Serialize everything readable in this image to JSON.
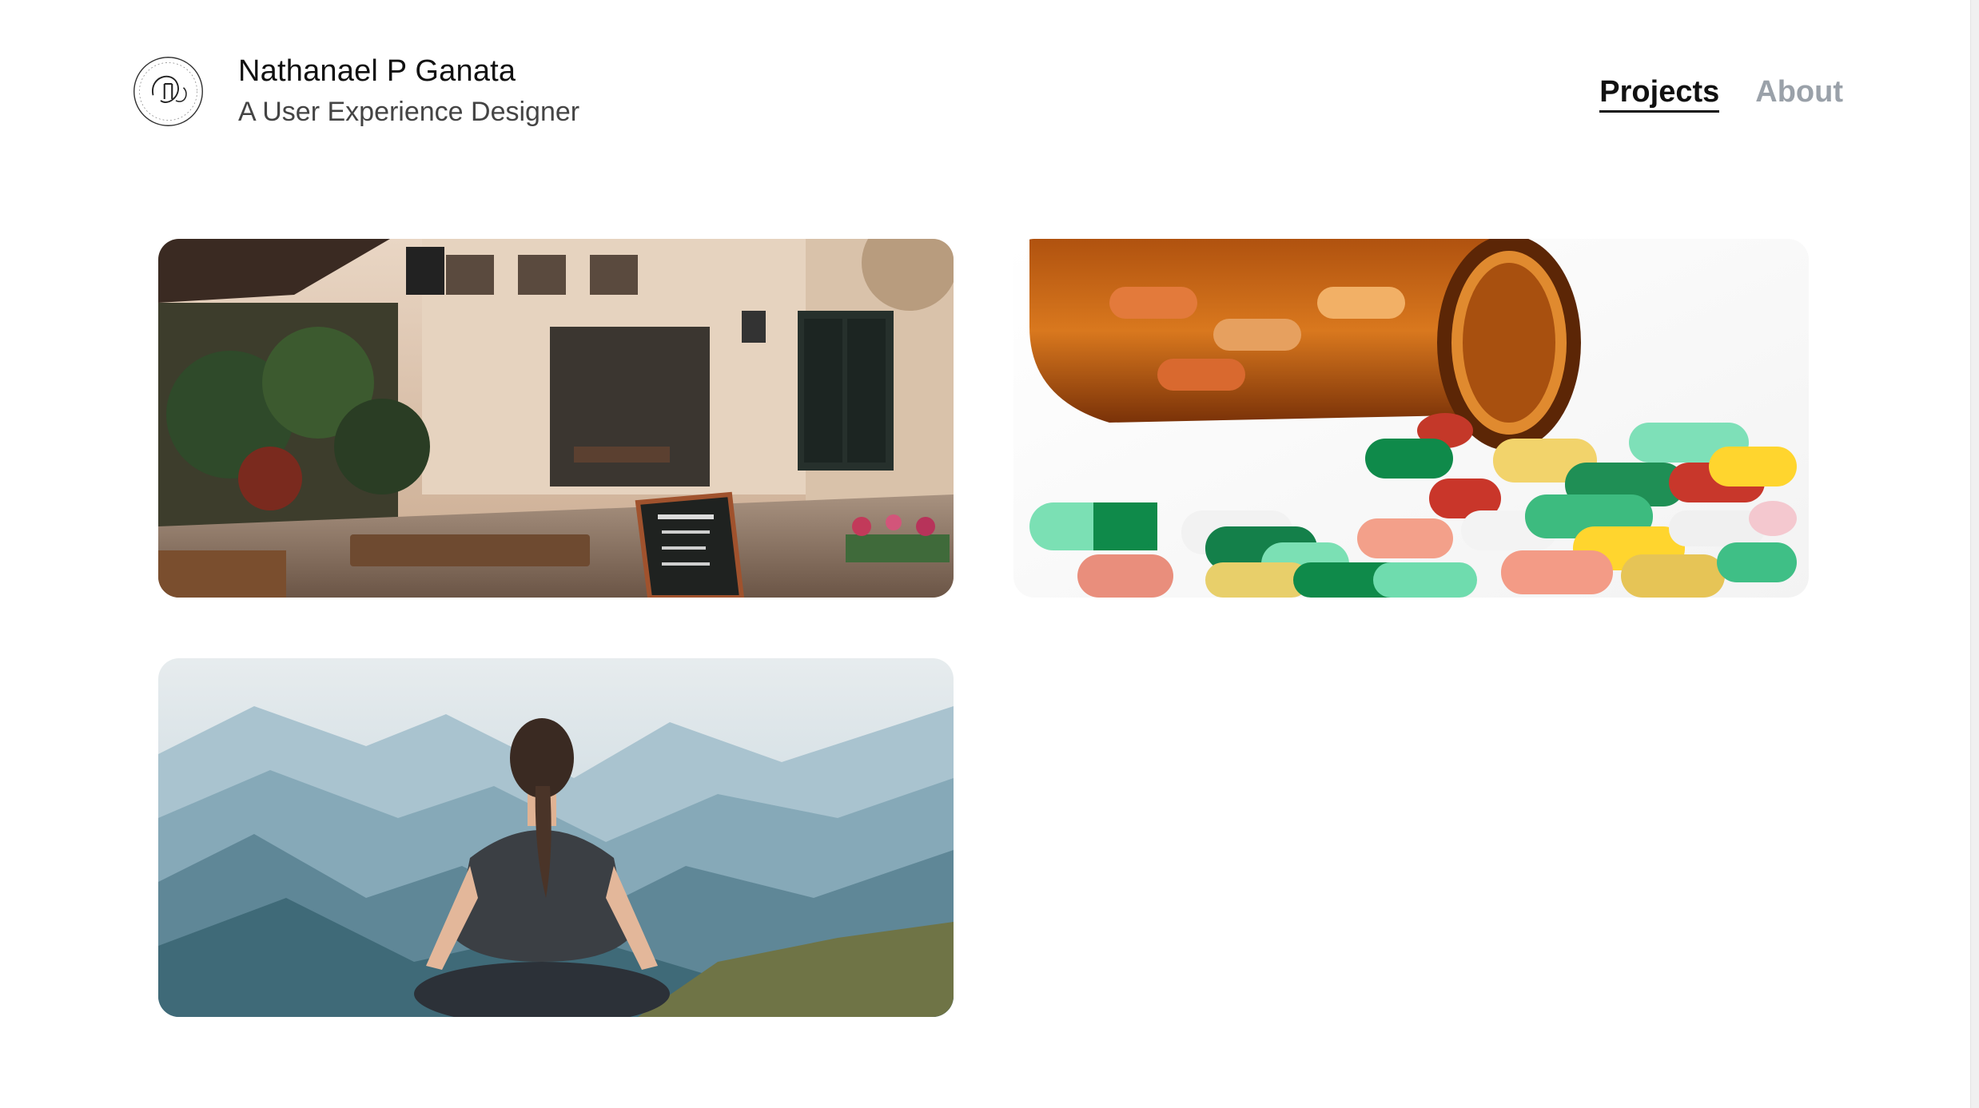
{
  "header": {
    "name": "Nathanael P Ganata",
    "role": "A User Experience Designer",
    "logo_icon": "circular-monogram-logo"
  },
  "nav": {
    "items": [
      {
        "label": "Projects",
        "active": true
      },
      {
        "label": "About",
        "active": false
      }
    ]
  },
  "projects": [
    {
      "image": "cafe-street-photo",
      "alt_hint": "coffee shop street"
    },
    {
      "image": "pills-bottle-photo",
      "alt_hint": "spilled capsules from amber bottle"
    },
    {
      "image": "meditation-mountains-photo",
      "alt_hint": "person meditating before mountains"
    }
  ],
  "colors": {
    "text_primary": "#111111",
    "text_muted": "#9aa1a9",
    "background": "#ffffff"
  }
}
